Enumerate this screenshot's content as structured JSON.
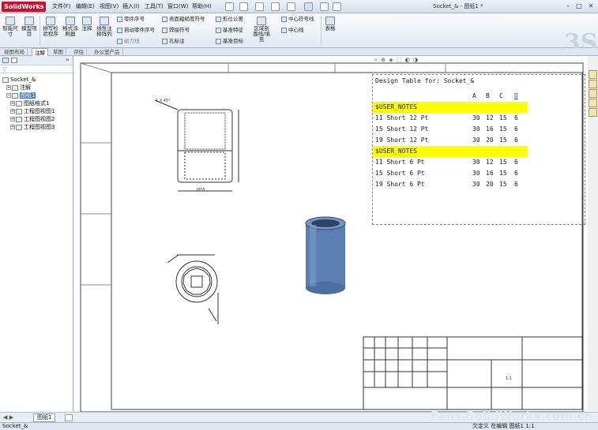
{
  "app": {
    "logo": "SolidWorks",
    "document_title": "Socket_& - 图纸1 *"
  },
  "menu": [
    "文件(F)",
    "编辑(E)",
    "视图(V)",
    "插入(I)",
    "工具(T)",
    "窗口(W)",
    "帮助(H)"
  ],
  "ribbon": {
    "smart_dim": "智能尺寸",
    "model_items": "模型项目",
    "spell_check": "拼写检验程序",
    "format_painter": "格式涂刷器",
    "note": "注释",
    "linear_pattern": "线性注释阵列",
    "balloon": "零件序号",
    "auto_balloon": "自动零件序号",
    "magnetic_line": "磁力线",
    "surface_finish": "表面粗糙度符号",
    "weld_symbol": "焊接符号",
    "hole_callout": "孔标注",
    "gtol": "形位公差",
    "datum_feature": "基准特征",
    "datum_target": "基准目标",
    "area_hatch": "区域剖面线/填充",
    "center_mark": "中心符号线",
    "centerline": "中心线",
    "tables": "表格"
  },
  "tabs": [
    "视图布局",
    "注解",
    "草图",
    "评估",
    "办公室产品"
  ],
  "active_tab": "注解",
  "tree": {
    "root": "Socket_&",
    "annotations": "注解",
    "sheet": "图纸1",
    "sheet_format": "图纸格式1",
    "views": [
      "工程图视图1",
      "工程图视图2",
      "工程图视图3"
    ]
  },
  "sheet_tab": "图纸1",
  "design_table": {
    "title": "Design Table for: Socket_&",
    "headers": [
      "A",
      "B",
      "C",
      "D"
    ],
    "rows": [
      {
        "label": "$USER_NOTES",
        "highlight": true,
        "values": [
          "",
          "",
          "",
          ""
        ]
      },
      {
        "label": "11 Short 12 Pt",
        "highlight": false,
        "values": [
          "30",
          "12",
          "15",
          "6"
        ]
      },
      {
        "label": "15 Short 12 Pt",
        "highlight": false,
        "values": [
          "30",
          "16",
          "15",
          "6"
        ]
      },
      {
        "label": "19 Short 12 Pt",
        "highlight": false,
        "values": [
          "30",
          "20",
          "15",
          "6"
        ]
      },
      {
        "label": "$USER_NOTES",
        "highlight": true,
        "values": [
          "",
          "",
          "",
          ""
        ]
      },
      {
        "label": "11 Short 6 Pt",
        "highlight": false,
        "values": [
          "30",
          "12",
          "15",
          "6"
        ]
      },
      {
        "label": "15 Short 6 Pt",
        "highlight": false,
        "values": [
          "30",
          "16",
          "15",
          "6"
        ]
      },
      {
        "label": "19 Short 6 Pt",
        "highlight": false,
        "values": [
          "30",
          "20",
          "15",
          "6"
        ]
      }
    ]
  },
  "dims": {
    "chamfer": "1 X 45°",
    "dia": "Ø18",
    "scale": "1:1"
  },
  "status": {
    "left": "Socket_&",
    "right": "欠定义  在编辑 图纸1  1:1"
  },
  "watermark": "Fans.SolidWorks.com.cn",
  "colors": {
    "accent": "#3a7bd5",
    "highlight": "#ffff00",
    "model": "#5b7fb2"
  }
}
